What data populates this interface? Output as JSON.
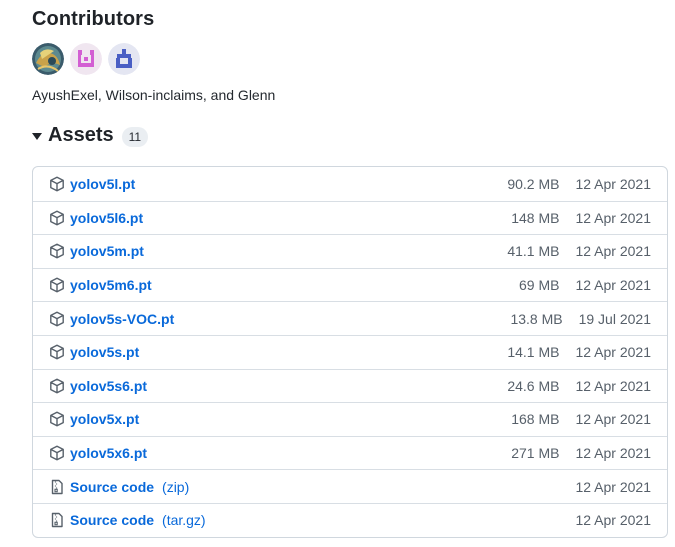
{
  "contributors": {
    "title": "Contributors",
    "names": "AyushExel, Wilson-inclaims, and Glenn",
    "avatars": [
      {
        "icon": "avatar-photo"
      },
      {
        "icon": "identicon-pink"
      },
      {
        "icon": "identicon-blue"
      }
    ]
  },
  "assets": {
    "title": "Assets",
    "count": "11",
    "items": [
      {
        "name": "yolov5l.pt",
        "size": "90.2 MB",
        "date": "12 Apr 2021",
        "icon": "package-icon"
      },
      {
        "name": "yolov5l6.pt",
        "size": "148 MB",
        "date": "12 Apr 2021",
        "icon": "package-icon"
      },
      {
        "name": "yolov5m.pt",
        "size": "41.1 MB",
        "date": "12 Apr 2021",
        "icon": "package-icon"
      },
      {
        "name": "yolov5m6.pt",
        "size": "69 MB",
        "date": "12 Apr 2021",
        "icon": "package-icon"
      },
      {
        "name": "yolov5s-VOC.pt",
        "size": "13.8 MB",
        "date": "19 Jul 2021",
        "icon": "package-icon"
      },
      {
        "name": "yolov5s.pt",
        "size": "14.1 MB",
        "date": "12 Apr 2021",
        "icon": "package-icon"
      },
      {
        "name": "yolov5s6.pt",
        "size": "24.6 MB",
        "date": "12 Apr 2021",
        "icon": "package-icon"
      },
      {
        "name": "yolov5x.pt",
        "size": "168 MB",
        "date": "12 Apr 2021",
        "icon": "package-icon"
      },
      {
        "name": "yolov5x6.pt",
        "size": "271 MB",
        "date": "12 Apr 2021",
        "icon": "package-icon"
      }
    ],
    "source": [
      {
        "name": "Source code",
        "ext": "(zip)",
        "date": "12 Apr 2021",
        "icon": "file-zip-icon"
      },
      {
        "name": "Source code",
        "ext": "(tar.gz)",
        "date": "12 Apr 2021",
        "icon": "file-zip-icon"
      }
    ]
  },
  "colors": {
    "link": "#0969da",
    "muted": "#57606a",
    "border": "#d0d7de"
  }
}
